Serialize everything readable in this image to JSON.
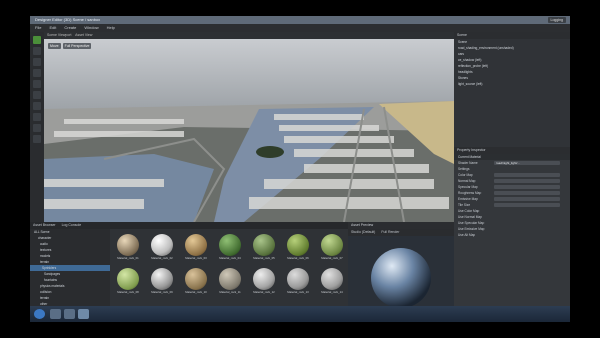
{
  "window": {
    "title": "Designer Editor (3D) Scene / sanbox"
  },
  "menu": [
    "File",
    "Edit",
    "Create",
    "Window",
    "Help"
  ],
  "header": {
    "login": "Logging"
  },
  "viewport": {
    "tabs": [
      "Scene Viewport",
      "Asset View"
    ],
    "tools": [
      "Move",
      "Full Perspective"
    ]
  },
  "scene_panel": {
    "title": "Scene",
    "items": [
      "Scene",
      "road_shading_environment (unshaded)",
      "cars",
      "ce_shadow (left)",
      "reflection_probe (left)",
      "headlights",
      "Stones",
      "light_source (left)"
    ]
  },
  "properties": {
    "title": "Property Inspector",
    "section": "Current Material",
    "rows": [
      {
        "label": "Shader Name",
        "value": "road/night_light/..."
      },
      {
        "label": "Settings",
        "value": ""
      },
      {
        "label": "Color Map",
        "value": ""
      },
      {
        "label": "Normal Map",
        "value": ""
      },
      {
        "label": "Specular Map",
        "value": ""
      },
      {
        "label": "Roughness Map",
        "value": ""
      },
      {
        "label": "Emissive Map",
        "value": ""
      },
      {
        "label": "Tile Size",
        "value": ""
      },
      {
        "label": "Use Color Map",
        "value": ""
      },
      {
        "label": "Use Normal Map",
        "value": ""
      },
      {
        "label": "Use Specular Map",
        "value": ""
      },
      {
        "label": "Use Emissive Map",
        "value": ""
      },
      {
        "label": "Use Alt Map",
        "value": ""
      }
    ]
  },
  "asset_browser": {
    "tabs": [
      "Asset Browser",
      "Log Console"
    ],
    "tree": [
      "ALL Scene",
      "character",
      "audio",
      "textures",
      "models",
      "terrain",
      "Sprinklers",
      "Sandpages",
      "fountains",
      "physics materials",
      "collision",
      "terrain",
      "other"
    ],
    "materials": [
      "Material_rock_01",
      "Material_rock_02",
      "Material_rock_03",
      "Material_rock_04",
      "Material_rock_05",
      "Material_rock_06",
      "Material_rock_07",
      "Material_rock_08",
      "Material_rock_09",
      "Material_rock_10",
      "Material_rock_11",
      "Material_rock_12",
      "Material_rock_13",
      "Material_rock_14"
    ]
  },
  "preview": {
    "title": "Asset Preview",
    "tabs": [
      "Studio (Default)",
      "Full Render"
    ]
  },
  "status": {
    "text": "Complete: Finished compiling 'materials' in 0.000 seconds"
  },
  "colors": {
    "accent": "#4b8f3a",
    "panel": "#34373b",
    "titlebar": "#5f6a78"
  }
}
